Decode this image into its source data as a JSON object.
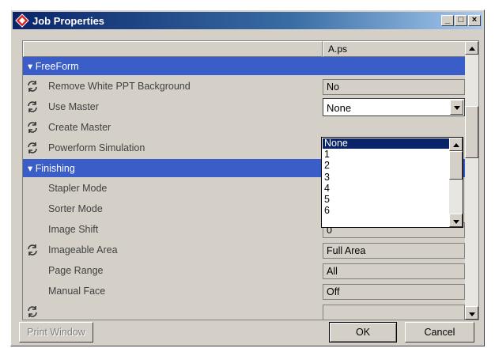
{
  "window": {
    "title": "Job Properties"
  },
  "titlebar_buttons": {
    "minimize": "_",
    "maximize": "□",
    "close": "×"
  },
  "grid": {
    "column_header": "A.ps",
    "rows": [
      {
        "kind": "section",
        "label": "FreeForm"
      },
      {
        "kind": "property",
        "label": "Remove White PPT Background",
        "value": "No",
        "icon": "refresh-icon"
      },
      {
        "kind": "combo",
        "label": "Use Master",
        "value": "None",
        "icon": "refresh-icon"
      },
      {
        "kind": "property",
        "label": "Create Master",
        "value": "",
        "icon": "refresh-icon"
      },
      {
        "kind": "property",
        "label": "Powerform Simulation",
        "value": "",
        "icon": "refresh-icon"
      },
      {
        "kind": "section",
        "label": "Finishing"
      },
      {
        "kind": "property",
        "label": "Stapler Mode",
        "value": ""
      },
      {
        "kind": "property",
        "label": "Sorter Mode",
        "value": ""
      },
      {
        "kind": "property",
        "label": "Image Shift",
        "value": "0"
      },
      {
        "kind": "property",
        "label": "Imageable Area",
        "value": "Full Area",
        "icon": "refresh-icon"
      },
      {
        "kind": "property",
        "label": "Page Range",
        "value": "All"
      },
      {
        "kind": "property",
        "label": "Manual Face",
        "value": "Off"
      },
      {
        "kind": "property",
        "label": "",
        "value": "",
        "icon": "refresh-icon"
      }
    ]
  },
  "dropdown": {
    "options": [
      "None",
      "1",
      "2",
      "3",
      "4",
      "5",
      "6"
    ],
    "selected": "None"
  },
  "buttons": {
    "print_window": "Print Window",
    "ok": "OK",
    "cancel": "Cancel"
  },
  "colors": {
    "section_bg": "#3a5dc8",
    "selection_bg": "#0a246a",
    "dialog_bg": "#d4d0c8"
  }
}
